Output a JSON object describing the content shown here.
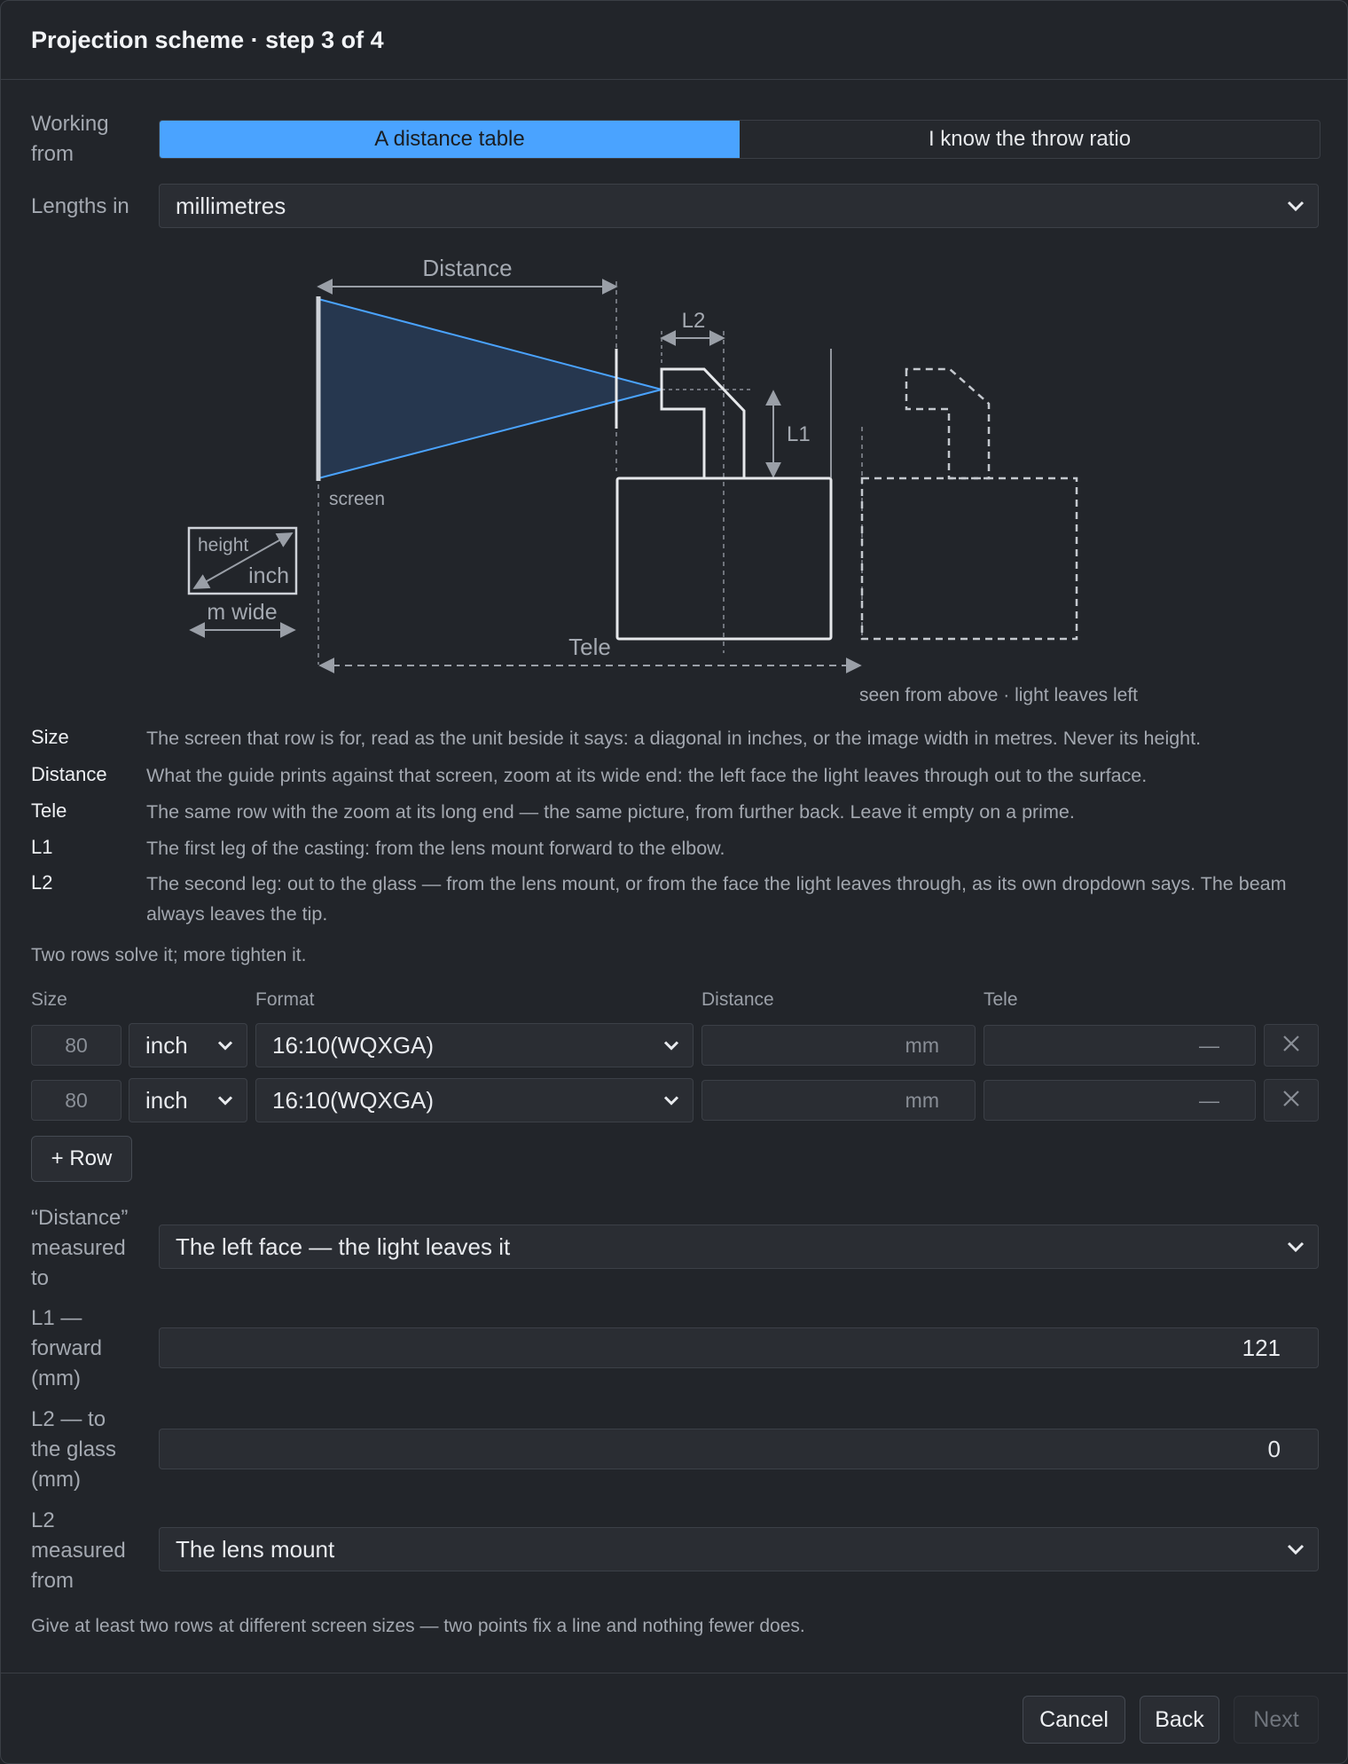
{
  "dialog": {
    "title": "Projection scheme · step 3 of 4"
  },
  "working_from": {
    "label": "Working from",
    "options": [
      "A distance table",
      "I know the throw ratio"
    ],
    "selected": "A distance table"
  },
  "lengths_in": {
    "label": "Lengths in",
    "value": "millimetres"
  },
  "diagram": {
    "distance": "Distance",
    "l2": "L2",
    "l1": "L1",
    "screen": "screen",
    "height": "height",
    "inch": "inch",
    "m_wide": "m wide",
    "tele": "Tele",
    "caption": "seen from above · light leaves left",
    "beam_color": "#4aa3ff"
  },
  "definitions": [
    {
      "term": "Size",
      "desc": "The screen that row is for, read as the unit beside it says: a diagonal in inches, or the image width in metres. Never its height."
    },
    {
      "term": "Distance",
      "desc": "What the guide prints against that screen, zoom at its wide end: the left face the light leaves through out to the surface."
    },
    {
      "term": "Tele",
      "desc": "The same row with the zoom at its long end — the same picture, from further back. Leave it empty on a prime."
    },
    {
      "term": "L1",
      "desc": "The first leg of the casting: from the lens mount forward to the elbow."
    },
    {
      "term": "L2",
      "desc": "The second leg: out to the glass — from the lens mount, or from the face the light leaves through, as its own dropdown says. The beam always leaves the tip."
    }
  ],
  "rows_hint": "Two rows solve it; more tighten it.",
  "table": {
    "headers": {
      "size": "Size",
      "format": "Format",
      "distance": "Distance",
      "tele": "Tele"
    },
    "rows": [
      {
        "size_placeholder": "80",
        "unit": "inch",
        "format": "16:10(WQXGA)",
        "distance_placeholder": "mm",
        "tele_placeholder": "—"
      },
      {
        "size_placeholder": "80",
        "unit": "inch",
        "format": "16:10(WQXGA)",
        "distance_placeholder": "mm",
        "tele_placeholder": "—"
      }
    ],
    "add_row": "+ Row"
  },
  "distance_measured_to": {
    "label": "“Distance” measured to",
    "value": "The left face — the light leaves it"
  },
  "l1_forward": {
    "label": "L1 — forward (mm)",
    "value": "121"
  },
  "l2_glass": {
    "label": "L2 — to the glass (mm)",
    "value": "0"
  },
  "l2_measured_from": {
    "label": "L2 measured from",
    "value": "The lens mount"
  },
  "bottom_hint": "Give at least two rows at different screen sizes — two points fix a line and nothing fewer does.",
  "footer": {
    "cancel": "Cancel",
    "back": "Back",
    "next": "Next"
  }
}
